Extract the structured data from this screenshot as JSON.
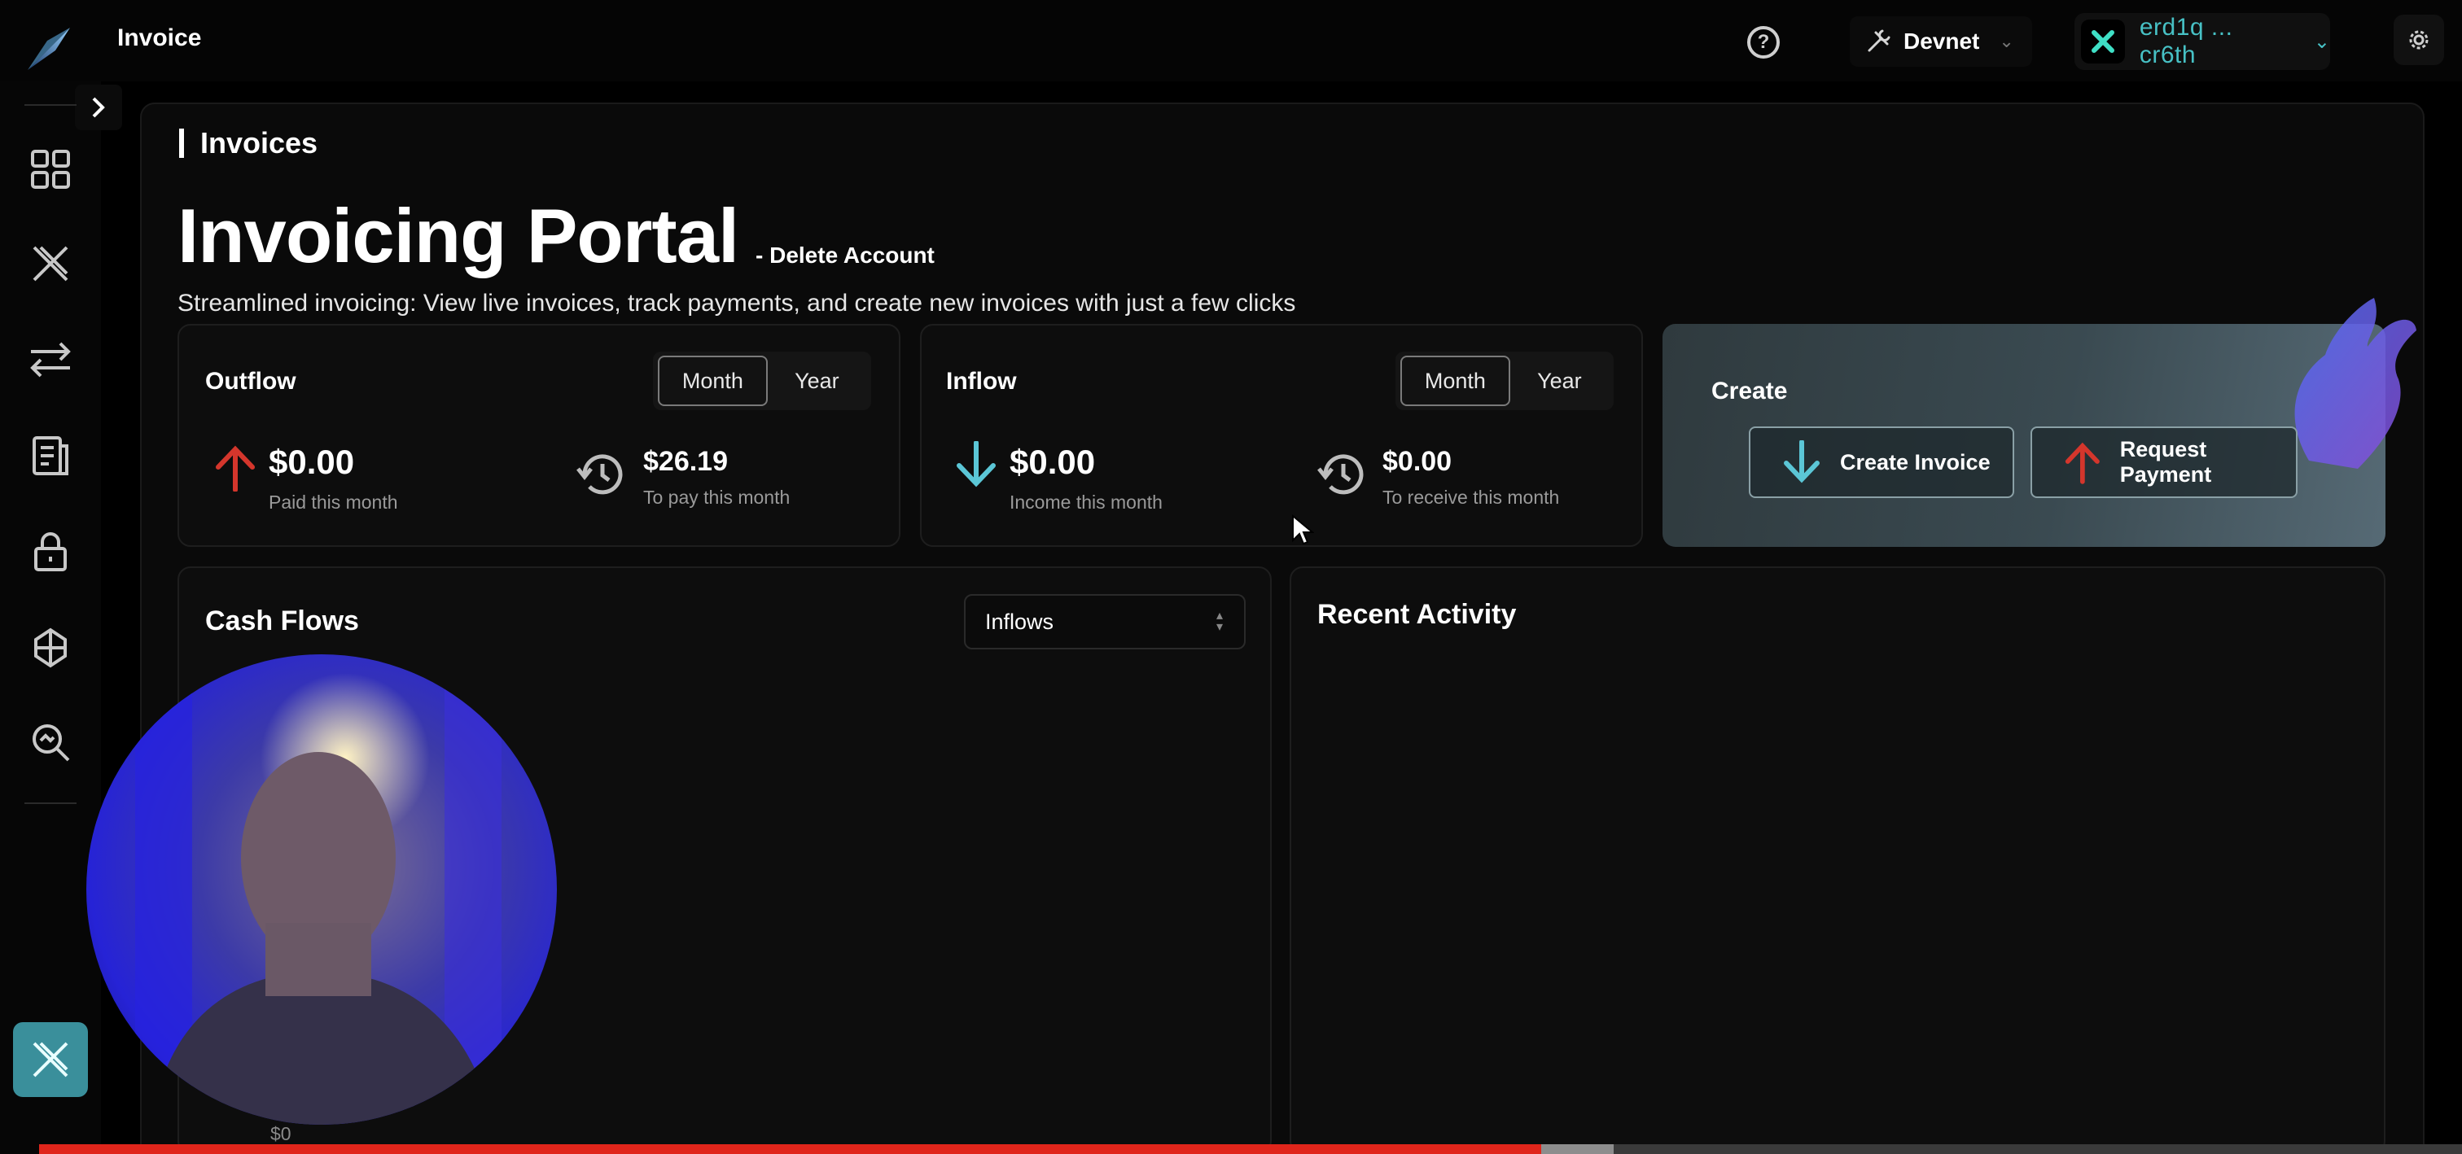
{
  "app": {
    "title": "Invoice"
  },
  "header": {
    "network_label": "Devnet",
    "wallet_address": "erd1q ... cr6th"
  },
  "page": {
    "section_title": "Invoices",
    "title": "Invoicing Portal",
    "delete_account": "- Delete Account",
    "subtitle": "Streamlined invoicing: View live invoices, track payments, and create new invoices with just a few clicks"
  },
  "outflow": {
    "title": "Outflow",
    "toggle": [
      "Month",
      "Year"
    ],
    "active_toggle": "Month",
    "paid_value": "$0.00",
    "paid_label": "Paid this month",
    "topay_value": "$26.19",
    "topay_label": "To pay this month"
  },
  "inflow": {
    "title": "Inflow",
    "toggle": [
      "Month",
      "Year"
    ],
    "active_toggle": "Month",
    "income_value": "$0.00",
    "income_label": "Income this month",
    "toreceive_value": "$0.00",
    "toreceive_label": "To receive this month"
  },
  "create": {
    "title": "Create",
    "create_invoice": "Create Invoice",
    "request_payment": "Request Payment"
  },
  "cash_flows": {
    "title": "Cash Flows",
    "select_value": "Inflows",
    "zero_tick": "$0"
  },
  "recent_activity": {
    "title": "Recent Activity"
  },
  "icons": {
    "sidebar": [
      "dashboard-icon",
      "multiversx-icon",
      "transfer-icon",
      "invoice-icon",
      "lock-icon",
      "staking-icon",
      "explorer-icon"
    ],
    "accent_up": "#d4362c",
    "accent_down": "#5bc6d6"
  },
  "video": {
    "progress": 0.62,
    "buffered_to": 0.65
  }
}
